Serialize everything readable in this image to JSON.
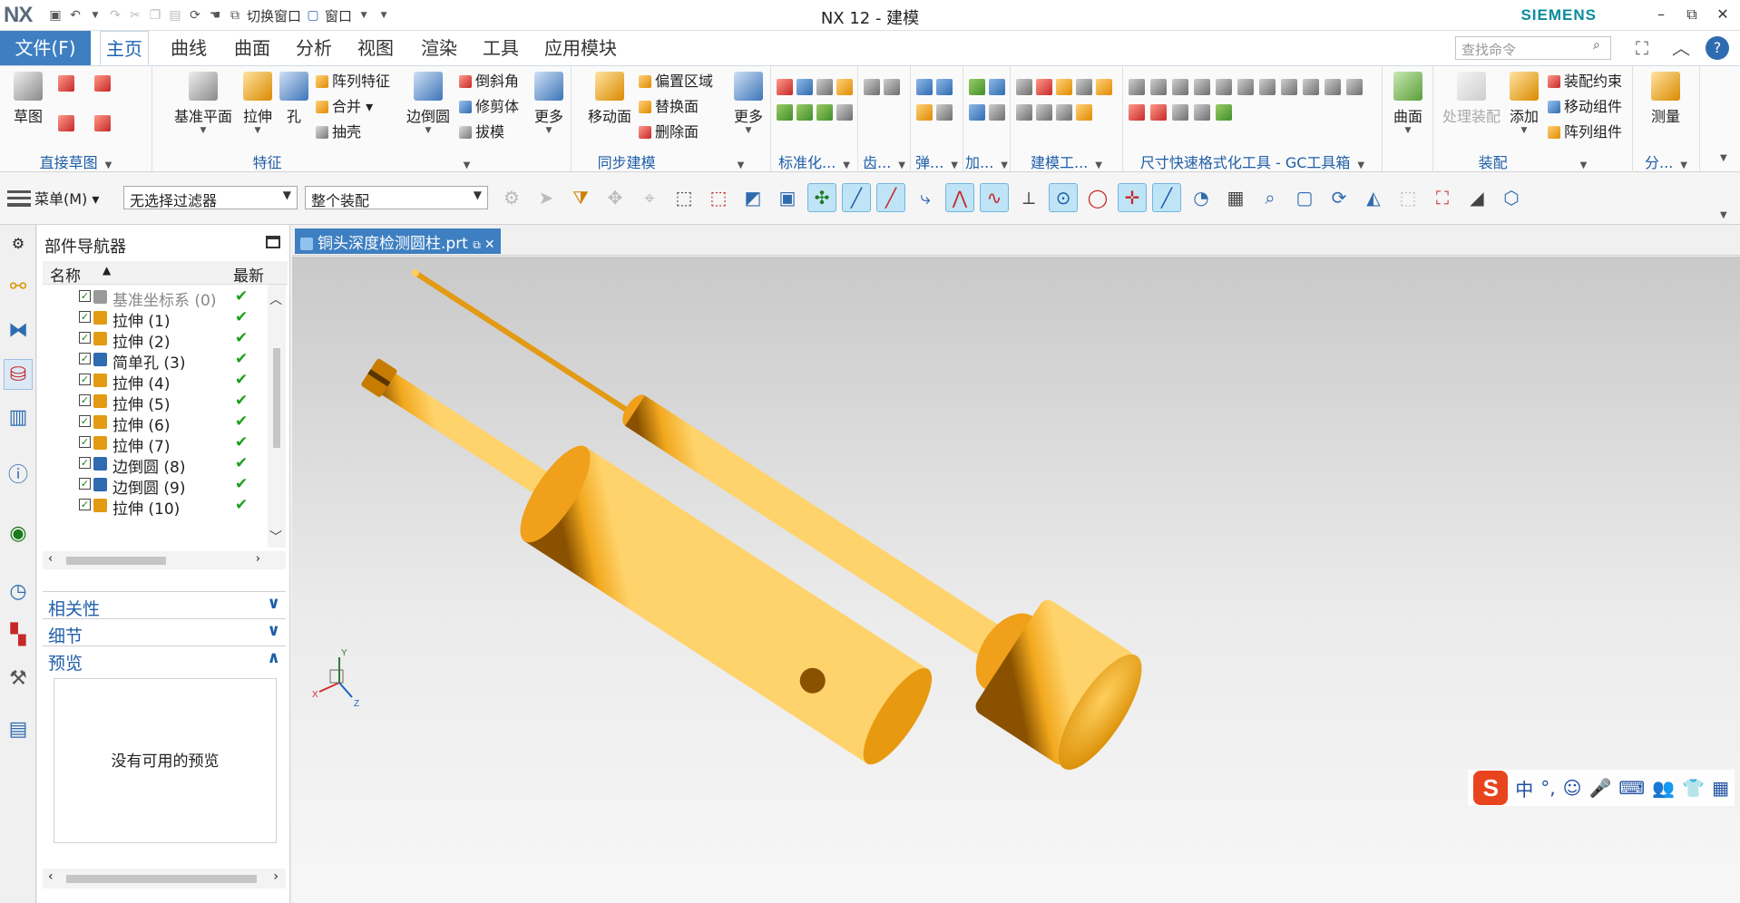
{
  "titlebar": {
    "app_logo": "NX",
    "title": "NX 12 - 建模",
    "brand": "SIEMENS",
    "switch_window": "切换窗口",
    "window_menu": "窗口",
    "minimize": "–",
    "restore": "⧉",
    "close": "✕"
  },
  "menu": {
    "file": "文件(F)",
    "tabs": [
      "主页",
      "曲线",
      "曲面",
      "分析",
      "视图",
      "渲染",
      "工具",
      "应用模块"
    ],
    "active_tab": "主页",
    "search_placeholder": "查找命令"
  },
  "ribbon": {
    "sketch_group": {
      "label": "直接草图",
      "sketch": "草图"
    },
    "feature_group": {
      "label": "特征",
      "datum_plane": "基准平面",
      "extrude": "拉伸",
      "hole": "孔",
      "pattern_feature": "阵列特征",
      "unite": "合并",
      "shell": "抽壳",
      "edge_blend": "边倒圆",
      "chamfer": "倒斜角",
      "trim_body": "修剪体",
      "draft": "拔模",
      "more": "更多"
    },
    "sync_group": {
      "label": "同步建模",
      "move_face": "移动面",
      "offset_region": "偏置区域",
      "replace_face": "替换面",
      "delete_face": "删除面",
      "more": "更多"
    },
    "standard_group": {
      "label": "标准化..."
    },
    "gear_group": {
      "label": "齿..."
    },
    "spring_group": {
      "label": "弹..."
    },
    "add_group": {
      "label": "加..."
    },
    "modeling_tools_group": {
      "label": "建模工..."
    },
    "gc_group": {
      "label": "尺寸快速格式化工具 - GC工具箱"
    },
    "surface_group": {
      "label": "曲面"
    },
    "assembly_group": {
      "label": "装配",
      "process_assembly": "处理装配",
      "add": "添加",
      "assembly_constraints": "装配约束",
      "move_component": "移动组件",
      "pattern_component": "阵列组件"
    },
    "measure": "测量",
    "analysis_group": {
      "label": "分..."
    }
  },
  "seltoolbar": {
    "menu": "菜单(M)",
    "filter": "无选择过滤器",
    "scope": "整个装配"
  },
  "navigator": {
    "title": "部件导航器",
    "col_name": "名称",
    "col_latest": "最新",
    "items": [
      {
        "label": "基准坐标系 (0)",
        "icon": "datum-csys",
        "dim": true
      },
      {
        "label": "拉伸 (1)",
        "icon": "extrude"
      },
      {
        "label": "拉伸 (2)",
        "icon": "extrude"
      },
      {
        "label": "简单孔 (3)",
        "icon": "hole"
      },
      {
        "label": "拉伸 (4)",
        "icon": "extrude"
      },
      {
        "label": "拉伸 (5)",
        "icon": "extrude"
      },
      {
        "label": "拉伸 (6)",
        "icon": "extrude"
      },
      {
        "label": "拉伸 (7)",
        "icon": "extrude"
      },
      {
        "label": "边倒圆 (8)",
        "icon": "edge-blend"
      },
      {
        "label": "边倒圆 (9)",
        "icon": "edge-blend"
      },
      {
        "label": "拉伸 (10)",
        "icon": "extrude"
      }
    ],
    "latest_mark": "✔",
    "sections": [
      "相关性",
      "细节",
      "预览"
    ],
    "preview_text": "没有可用的预览"
  },
  "document": {
    "tab_title": "铜头深度检测圆柱.prt"
  },
  "view_triad": {
    "x": "X",
    "y": "Y",
    "z": "Z"
  },
  "ime": {
    "logo": "S",
    "lang": "中",
    "punct": "°,"
  },
  "colors": {
    "accent": "#3e7fc1",
    "model": "#f2a81d",
    "check": "#1da01d"
  }
}
